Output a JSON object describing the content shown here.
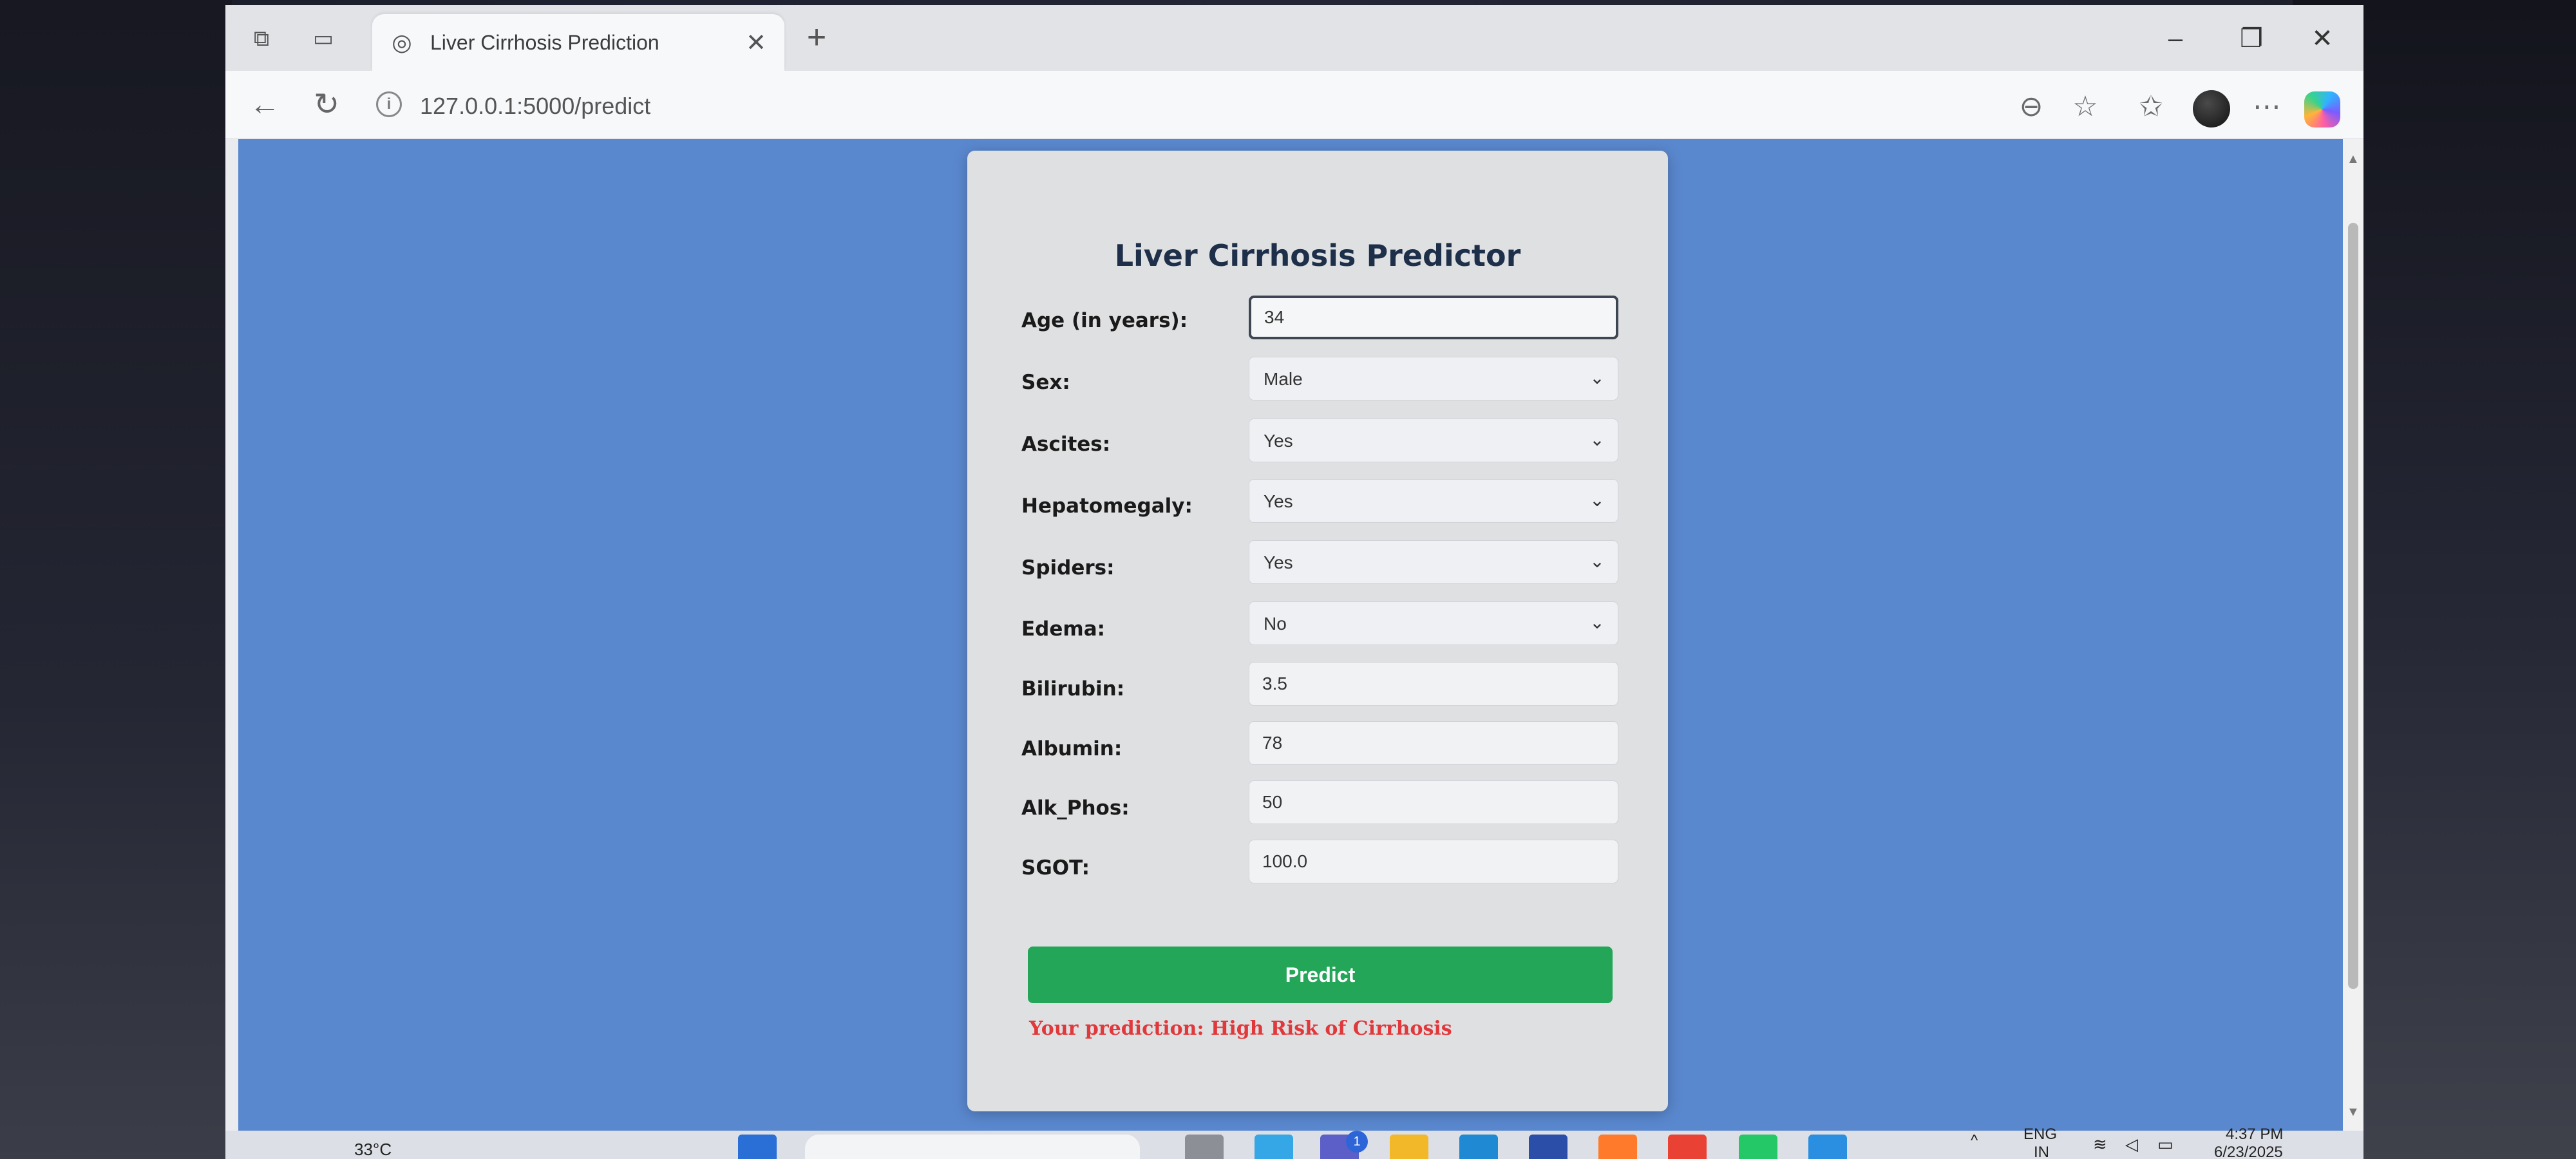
{
  "browser": {
    "tab_title": "Liver Cirrhosis Prediction",
    "url": "127.0.0.1:5000/predict"
  },
  "form": {
    "title": "Liver Cirrhosis Predictor",
    "fields": [
      {
        "label": "Age (in years):",
        "value": "34"
      },
      {
        "label": "Sex:",
        "value": "Male"
      },
      {
        "label": "Ascites:",
        "value": "Yes"
      },
      {
        "label": "Hepatomegaly:",
        "value": "Yes"
      },
      {
        "label": "Spiders:",
        "value": "Yes"
      },
      {
        "label": "Edema:",
        "value": "No"
      },
      {
        "label": "Bilirubin:",
        "value": "3.5"
      },
      {
        "label": "Albumin:",
        "value": "78"
      },
      {
        "label": "Alk_Phos:",
        "value": "50"
      },
      {
        "label": "SGOT:",
        "value": "100.0"
      }
    ],
    "predict_label": "Predict",
    "result": "Your prediction: High Risk of Cirrhosis"
  },
  "taskbar": {
    "weather": "33°C",
    "language": "ENG",
    "region": "IN",
    "time": "4:37 PM",
    "date": "6/23/2025",
    "teams_badge": "1"
  },
  "colors": {
    "page_background": "#5a88cf",
    "predict_button": "#24a659",
    "result_text": "#e0383b",
    "title_text": "#1e2f4a"
  }
}
